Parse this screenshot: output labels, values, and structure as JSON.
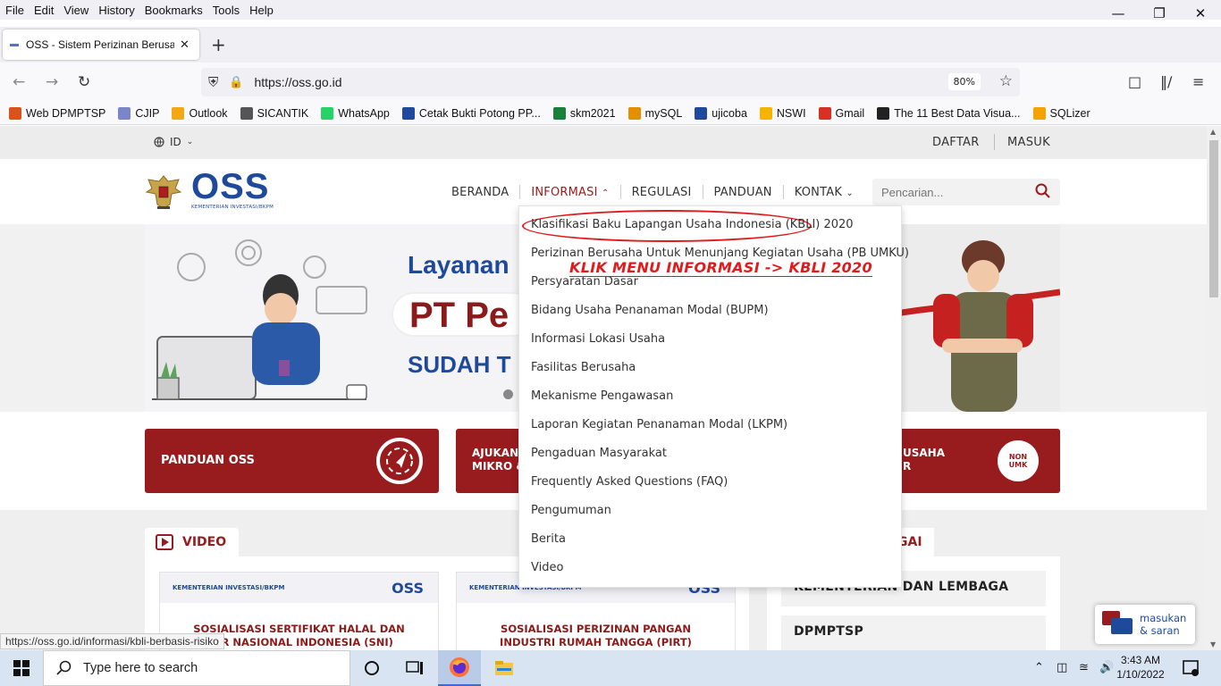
{
  "browser": {
    "menu": [
      "File",
      "Edit",
      "View",
      "History",
      "Bookmarks",
      "Tools",
      "Help"
    ],
    "tab_title": "OSS - Sistem Perizinan Berusaha",
    "url": "https://oss.go.id",
    "zoom": "80%",
    "bookmarks": [
      {
        "label": "Web DPMPTSP",
        "color": "#d9541c"
      },
      {
        "label": "CJIP",
        "color": "#7a86c9"
      },
      {
        "label": "Outlook",
        "color": "#f3a712"
      },
      {
        "label": "SICANTIK",
        "color": "#555555"
      },
      {
        "label": "WhatsApp",
        "color": "#25d366"
      },
      {
        "label": "Cetak Bukti Potong PP...",
        "color": "#1f4a9c"
      },
      {
        "label": "skm2021",
        "color": "#188038"
      },
      {
        "label": "mySQL",
        "color": "#e48e00"
      },
      {
        "label": "ujicoba",
        "color": "#1f4a9c"
      },
      {
        "label": "NSWI",
        "color": "#f4b400"
      },
      {
        "label": "Gmail",
        "color": "#d93025"
      },
      {
        "label": "The 11 Best Data Visua...",
        "color": "#222222"
      },
      {
        "label": "SQLizer",
        "color": "#f4a300"
      }
    ]
  },
  "page": {
    "lang": "ID",
    "daftar": "DAFTAR",
    "masuk": "MASUK",
    "logo_sub": "KEMENTERIAN INVESTASI/BKPM",
    "logo_text": "OSS",
    "nav": [
      "BERANDA",
      "INFORMASI",
      "REGULASI",
      "PANDUAN",
      "KONTAK"
    ],
    "search_placeholder": "Pencarian...",
    "banner": {
      "line1": "Layanan",
      "line2": "PT Pe",
      "line3": "SUDAH T"
    },
    "cards": {
      "panduan": "PANDUAN OSS",
      "ajukan": "AJUKAN\nMIKRO &",
      "usaha": "USAHA\nR",
      "badge": "NON\nUMK"
    },
    "video_tab": "VIDEO",
    "videos": [
      {
        "header": "KEMENTERIAN INVESTASI/BKPM",
        "caption": "SOSIALISASI SERTIFIKAT HALAL DAN\nDAR NASIONAL INDONESIA (SNI)"
      },
      {
        "header": "KEMENTERIAN INVESTASI/BKPM",
        "caption": "SOSIALISASI PERIZINAN PANGAN\nINDUSTRI RUMAH TANGGA (PIRT)"
      }
    ],
    "right_tab": "GAI",
    "right_items": [
      "KEMENTERIAN DAN LEMBAGA",
      "DPMPTSP"
    ],
    "dropdown": [
      "Klasifikasi Baku Lapangan Usaha Indonesia (KBLI) 2020",
      "Perizinan Berusaha Untuk Menunjang Kegiatan Usaha (PB UMKU)",
      "Persyaratan Dasar",
      "Bidang Usaha Penanaman Modal (BUPM)",
      "Informasi Lokasi Usaha",
      "Fasilitas Berusaha",
      "Mekanisme Pengawasan",
      "Laporan Kegiatan Penanaman Modal (LKPM)",
      "Pengaduan Masyarakat",
      "Frequently Asked Questions (FAQ)",
      "Pengumuman",
      "Berita",
      "Video"
    ],
    "annotation": "KLIK MENU INFORMASI -> KBLI 2020",
    "status_url": "https://oss.go.id/informasi/kbli-berbasis-risiko",
    "feedback": "masukan\n& saran",
    "brand_colors": {
      "red": "#981b1e",
      "blue": "#1f4a9c",
      "annotation": "#e01b1b"
    }
  },
  "taskbar": {
    "search": "Type here to search",
    "time": "3:43 AM",
    "date": "1/10/2022"
  }
}
